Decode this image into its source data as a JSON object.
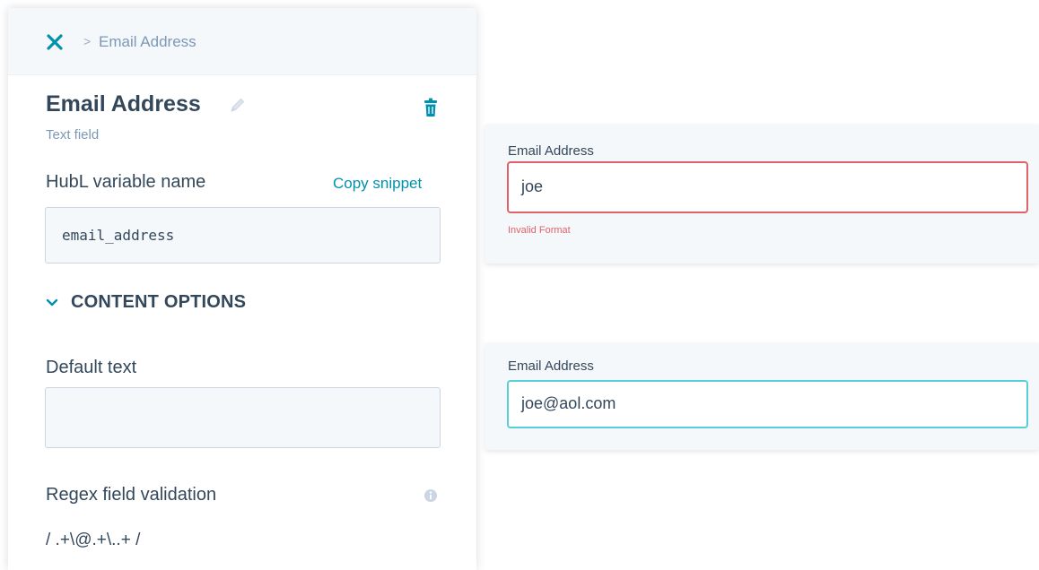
{
  "breadcrumb": {
    "separator": ">",
    "current": "Email Address"
  },
  "field": {
    "title": "Email Address",
    "type": "Text field"
  },
  "hubl": {
    "label": "HubL variable name",
    "copy_label": "Copy snippet",
    "value": "email_address"
  },
  "content_options": {
    "label": "CONTENT OPTIONS",
    "expanded": true
  },
  "default_text": {
    "label": "Default text",
    "value": ""
  },
  "regex": {
    "label": "Regex field validation",
    "value": "/ .+\\@.+\\..+ /"
  },
  "preview_invalid": {
    "label": "Email Address",
    "value": "joe",
    "error": "Invalid Format"
  },
  "preview_valid": {
    "label": "Email Address",
    "value": "joe@aol.com"
  },
  "icons": {
    "close": "close-icon",
    "edit": "pencil-icon",
    "delete": "trash-icon",
    "expand": "chevron-down-icon",
    "info": "info-icon"
  },
  "colors": {
    "accent": "#0091ae",
    "error": "#e06268",
    "focus": "#58cfd8",
    "text": "#33475b",
    "muted": "#7c98b6"
  }
}
